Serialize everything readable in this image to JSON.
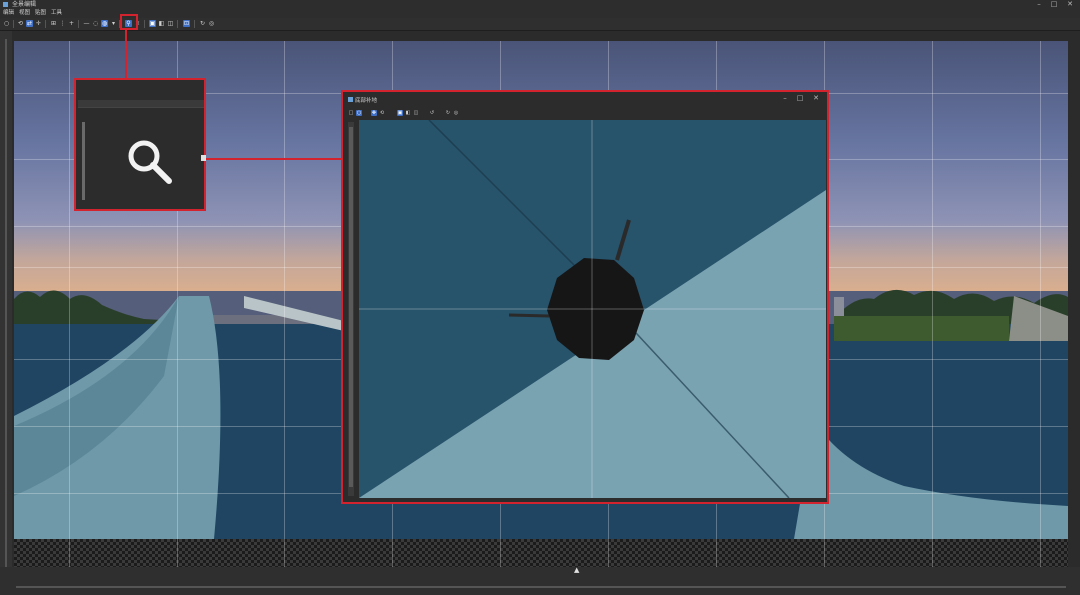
{
  "window": {
    "title": "全景编辑"
  },
  "menu": [
    "编辑",
    "视图",
    "贴图",
    "工具"
  ],
  "toolbar": {
    "active_tool": "search-icon",
    "highlighted_tool": "search-icon",
    "icons": [
      "select-icon",
      "rotate-icon",
      "move-icon",
      "stitch-icon",
      "plane-icon",
      "zoom-icon",
      "search-icon",
      "view-icon",
      "layout-icon",
      "sync-icon"
    ]
  },
  "dialog": {
    "title": "底部补地"
  },
  "colors": {
    "highlight": "#d2232f",
    "toolbar_active": "#3f6fc5",
    "window_bg": "#2b2b2b"
  }
}
